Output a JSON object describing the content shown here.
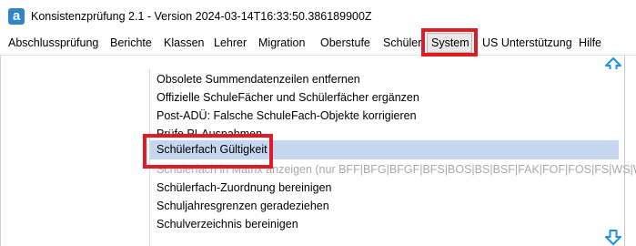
{
  "window": {
    "title": "Konsistenzprüfung 2.1 - Version 2024-03-14T16:33:50.386189900Z",
    "icon_letter": "a"
  },
  "menubar": {
    "items": [
      {
        "label": "Abschlussprüfung"
      },
      {
        "label": "Berichte"
      },
      {
        "label": "Klassen"
      },
      {
        "label": "Lehrer"
      },
      {
        "label": "Migration"
      },
      {
        "label": "Oberstufe"
      },
      {
        "label": "Schüler"
      },
      {
        "label": "System"
      },
      {
        "label": "US Unterstützung"
      },
      {
        "label": "Hilfe"
      }
    ],
    "active": "System"
  },
  "dropdown": {
    "items": [
      {
        "label": "Obsolete Summendatenzeilen entfernen",
        "state": "enabled"
      },
      {
        "label": "Offizielle SchuleFächer und Schülerfächer ergänzen",
        "state": "enabled"
      },
      {
        "label": "Post-ADÜ: Falsche SchuleFach-Objekte korrigieren",
        "state": "enabled"
      },
      {
        "label": "Prüfe PI-Ausnahmen",
        "state": "enabled"
      },
      {
        "label": "Schülerfach Gültigkeit",
        "state": "selected"
      },
      {
        "label": "Schülerfach in Matrix anzeigen (nur BFF|BFG|BFGF|BFS|BOS|BS|BSF|FAK|FOF|FOS|FS|WS|WSF)",
        "state": "disabled"
      },
      {
        "label": "Schülerfach-Zuordnung bereinigen",
        "state": "enabled"
      },
      {
        "label": "Schuljahresgrenzen geradeziehen",
        "state": "enabled"
      },
      {
        "label": "Schulverzeichnis bereinigen",
        "state": "enabled"
      }
    ]
  },
  "icons": {
    "scroll_up": "scroll-up-arrow-icon",
    "scroll_down": "scroll-down-arrow-icon"
  },
  "colors": {
    "highlight_box": "#e01b24",
    "selection": "#c5d7ee",
    "scroll_arrow": "#1e90e6",
    "app_icon": "#2f86c8"
  }
}
